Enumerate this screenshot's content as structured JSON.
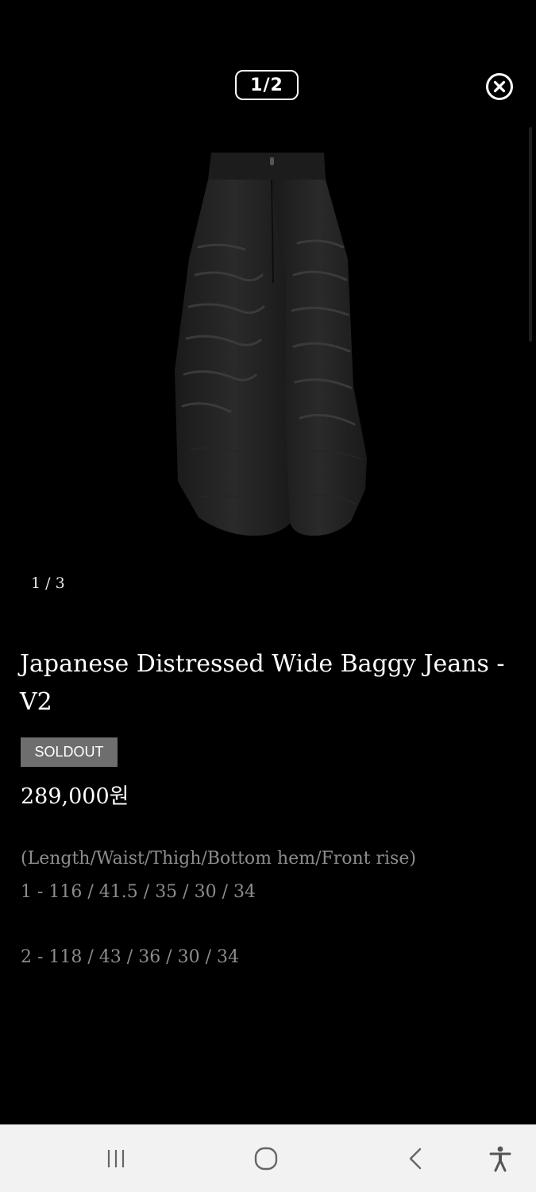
{
  "viewer": {
    "pager": "1/2",
    "close_icon": "close-circle-icon"
  },
  "gallery": {
    "counter": "1 / 3",
    "image_alt": "Black distressed wide baggy jeans"
  },
  "product": {
    "title": "Japanese Distressed Wide Baggy Jeans - V2",
    "badge": "SOLDOUT",
    "price": "289,000원",
    "specs_header": "(Length/Waist/Thigh/Bottom hem/Front rise)",
    "sizes": [
      "1 - 116 / 41.5 / 35 / 30 / 34",
      "2 - 118 / 43 / 36 / 30 / 34"
    ]
  },
  "navbar": {
    "icons": [
      "recent-apps-icon",
      "home-icon",
      "back-icon",
      "accessibility-icon"
    ]
  },
  "colors": {
    "background": "#000000",
    "badge": "#6e6e6e",
    "spec_text": "#8c8c8c",
    "navbar": "#f2f2f2"
  }
}
